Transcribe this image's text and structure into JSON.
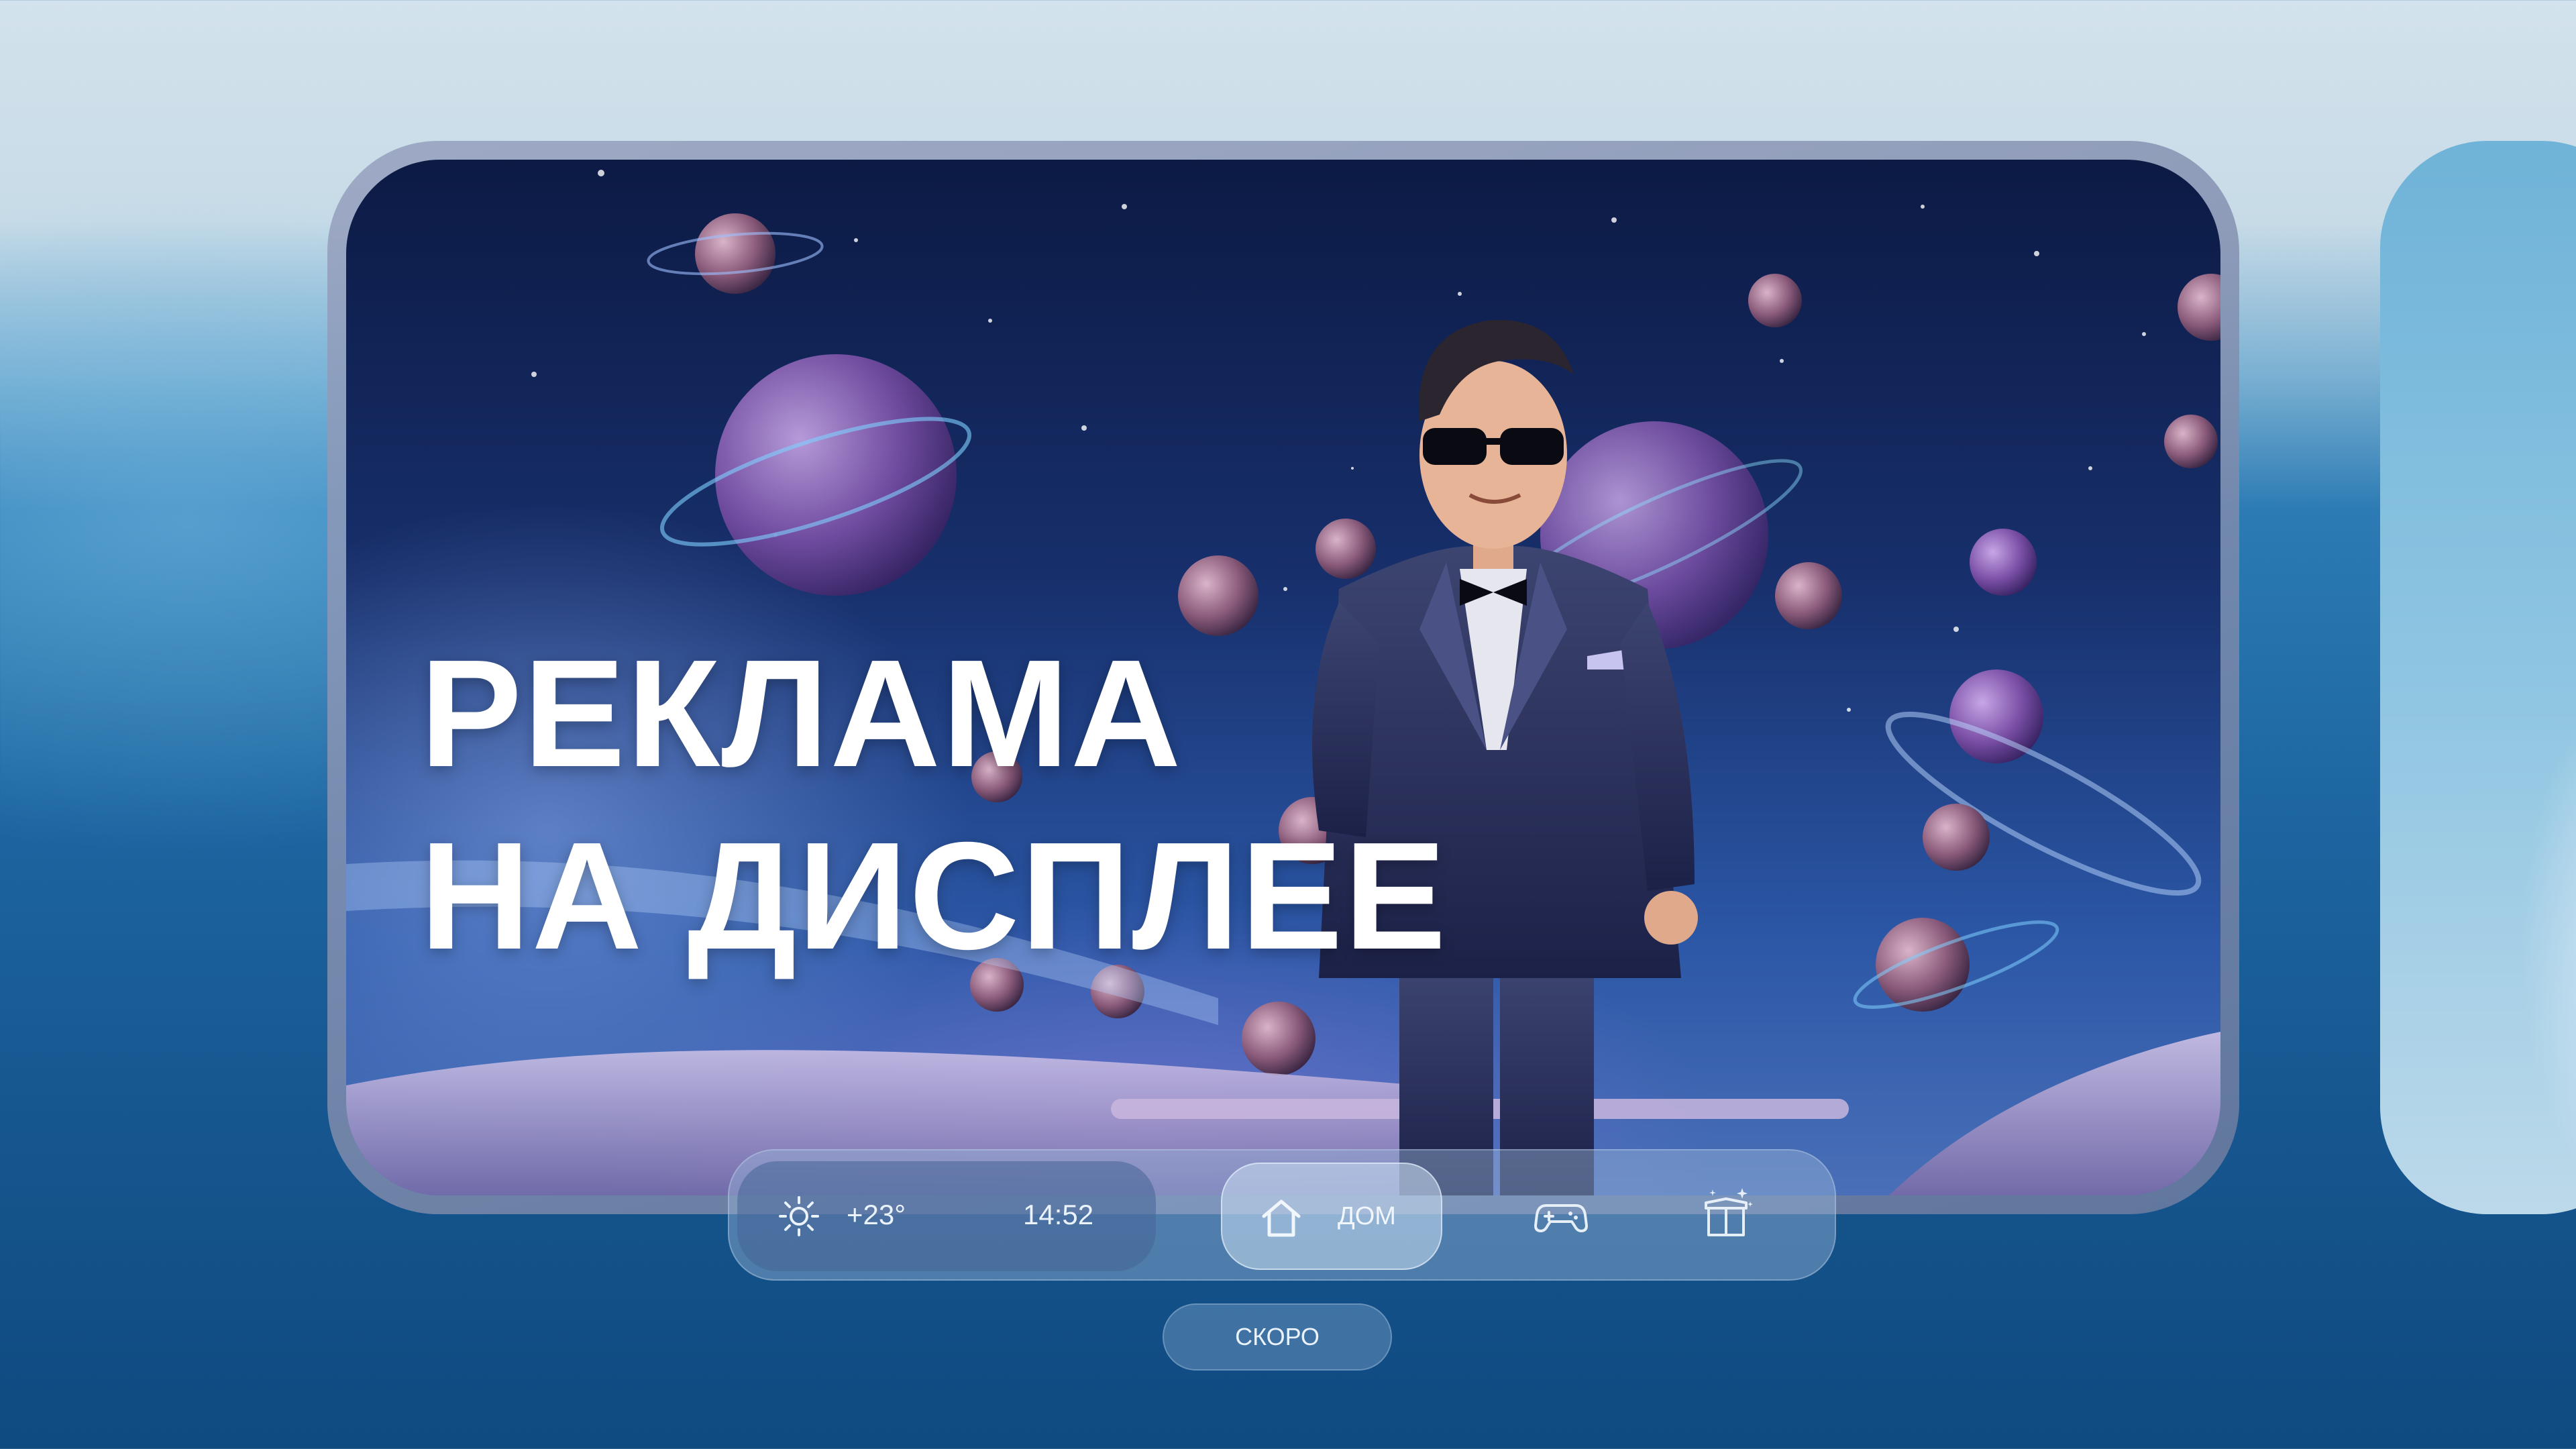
{
  "banner": {
    "headline_line1": "РЕКЛАМА",
    "headline_line2": "НА ДИСПЛЕЕ"
  },
  "dock": {
    "weather_icon": "sun-icon",
    "temperature": "+23°",
    "time": "14:52",
    "home_icon": "home-icon",
    "home_label": "ДОМ",
    "games_icon": "gamepad-icon",
    "gifts_icon": "gift-box-icon"
  },
  "soon_label": "СКОРО",
  "colors": {
    "headline": "#ffffff",
    "dock_text": "#eaf2fb",
    "background_top": "#d3e2ec",
    "background_bottom": "#0f4a80"
  }
}
